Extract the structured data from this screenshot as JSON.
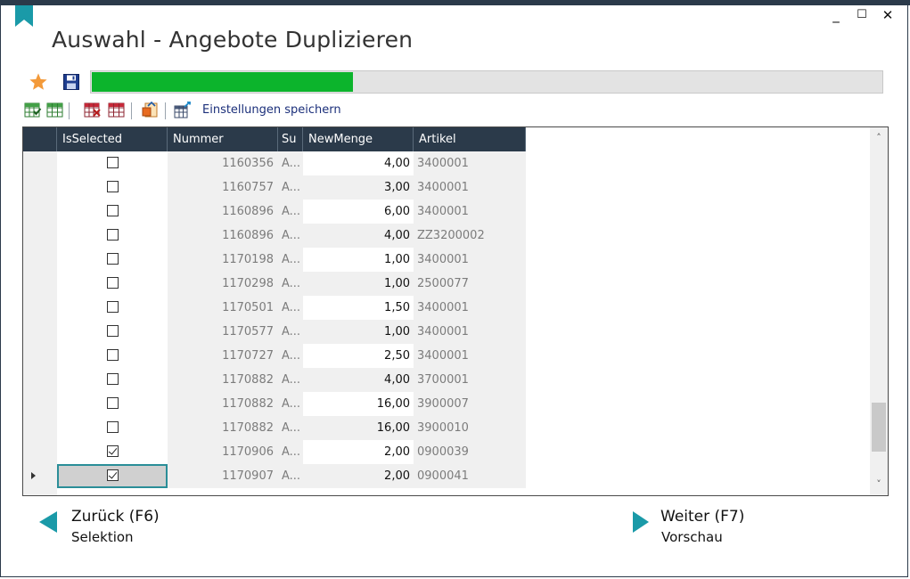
{
  "window": {
    "title": "Auswahl - Angebote Duplizieren",
    "controls": {
      "minimize": "_",
      "maximize": "☐",
      "close": "✕"
    }
  },
  "progress": {
    "fraction": 0.33,
    "fill_color": "#0cb42c"
  },
  "toolbar": {
    "icons": [
      "grid-select-all-icon",
      "grid-green-icon",
      "grid-deselect-icon",
      "grid-red-icon",
      "export-icon",
      "grid-settings-icon"
    ],
    "save_settings_label": "Einstellungen speichern"
  },
  "grid": {
    "columns": [
      "IsSelected",
      "Nummer",
      "Su",
      "NewMenge",
      "Artikel"
    ],
    "rows": [
      {
        "selected": false,
        "nummer": "1160356",
        "su": "A...",
        "menge": "4,00",
        "artikel": "3400001"
      },
      {
        "selected": false,
        "nummer": "1160757",
        "su": "A...",
        "menge": "3,00",
        "artikel": "3400001"
      },
      {
        "selected": false,
        "nummer": "1160896",
        "su": "A...",
        "menge": "6,00",
        "artikel": "3400001"
      },
      {
        "selected": false,
        "nummer": "1160896",
        "su": "A...",
        "menge": "4,00",
        "artikel": "ZZ3200002"
      },
      {
        "selected": false,
        "nummer": "1170198",
        "su": "A...",
        "menge": "1,00",
        "artikel": "3400001"
      },
      {
        "selected": false,
        "nummer": "1170298",
        "su": "A...",
        "menge": "1,00",
        "artikel": "2500077"
      },
      {
        "selected": false,
        "nummer": "1170501",
        "su": "A...",
        "menge": "1,50",
        "artikel": "3400001"
      },
      {
        "selected": false,
        "nummer": "1170577",
        "su": "A...",
        "menge": "1,00",
        "artikel": "3400001"
      },
      {
        "selected": false,
        "nummer": "1170727",
        "su": "A...",
        "menge": "2,50",
        "artikel": "3400001"
      },
      {
        "selected": false,
        "nummer": "1170882",
        "su": "A...",
        "menge": "4,00",
        "artikel": "3700001"
      },
      {
        "selected": false,
        "nummer": "1170882",
        "su": "A...",
        "menge": "16,00",
        "artikel": "3900007"
      },
      {
        "selected": false,
        "nummer": "1170882",
        "su": "A...",
        "menge": "16,00",
        "artikel": "3900010"
      },
      {
        "selected": true,
        "nummer": "1170906",
        "su": "A...",
        "menge": "2,00",
        "artikel": "0900039"
      },
      {
        "selected": true,
        "nummer": "1170907",
        "su": "A...",
        "menge": "2,00",
        "artikel": "0900041",
        "current": true
      }
    ],
    "scroll_position": 0.92
  },
  "nav": {
    "back": {
      "label": "Zurück (F6)",
      "sub": "Selektion"
    },
    "next": {
      "label": "Weiter (F7)",
      "sub": "Vorschau"
    }
  },
  "colors": {
    "header_bg": "#2b3a4a",
    "accent_teal": "#1a9aa8",
    "link": "#1b2f7a"
  }
}
